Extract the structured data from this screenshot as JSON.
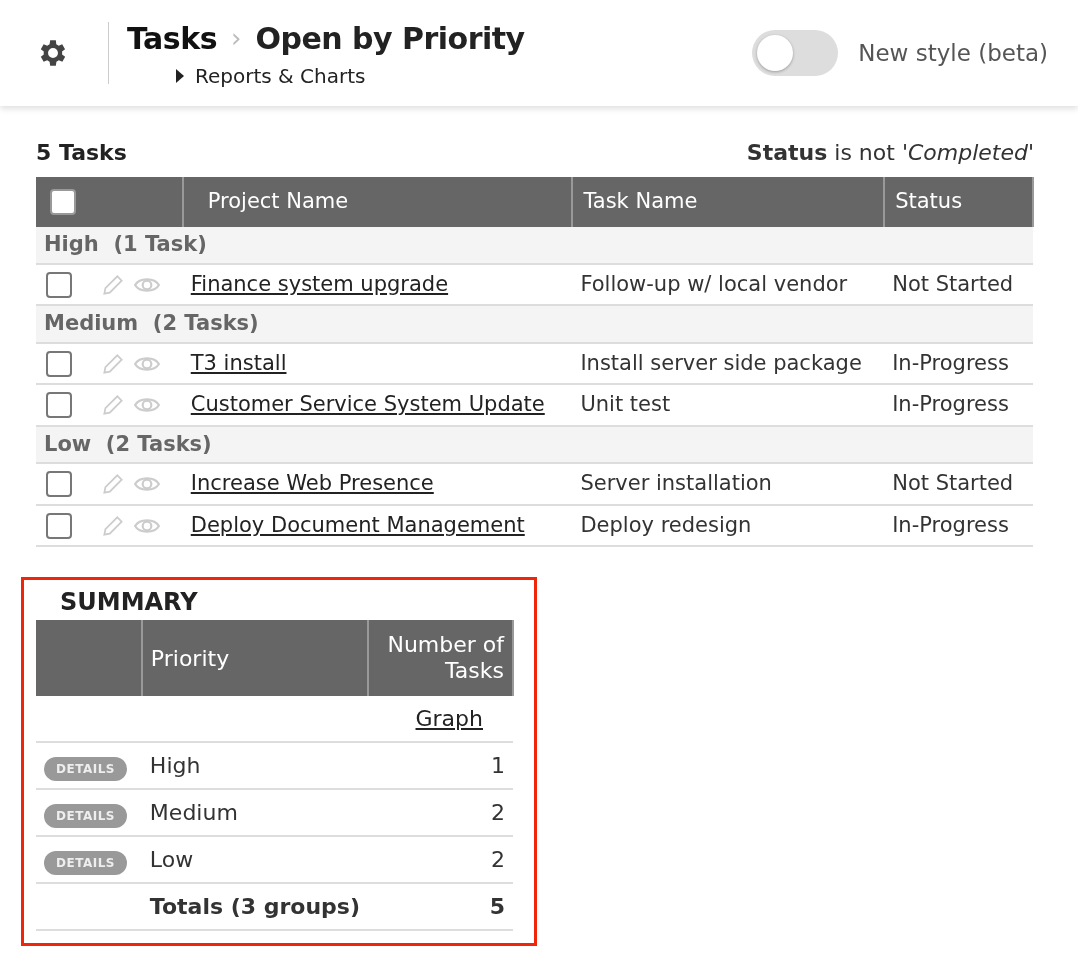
{
  "header": {
    "breadcrumb": "Tasks",
    "separator": "›",
    "title": "Open by Priority",
    "submenu": "Reports & Charts",
    "toggle": {
      "label": "New style (beta)",
      "on": false
    }
  },
  "list": {
    "count": "5 Tasks",
    "filter": "**Status** is not *'Completed'*",
    "select_all": {
      "checked": false
    },
    "columns": [
      "Project Name",
      "Task Name",
      "Status"
    ],
    "groups": [
      {
        "label": "High  (1 Task)",
        "rows": [
          {
            "project": "Finance system upgrade",
            "task": "Follow-up w/ local vendor",
            "status": "Not Started",
            "checked": false
          }
        ]
      },
      {
        "label": "Medium  (2 Tasks)",
        "rows": [
          {
            "project": "T3 install",
            "task": "Install server side package",
            "status": "In-Progress",
            "checked": false
          },
          {
            "project": "Customer Service System Update",
            "task": "Unit test",
            "status": "In-Progress",
            "checked": false
          }
        ]
      },
      {
        "label": "Low  (2 Tasks)",
        "rows": [
          {
            "project": "Increase Web Presence",
            "task": "Server installation",
            "status": "Not Started",
            "checked": false
          },
          {
            "project": "Deploy Document Management",
            "task": "Deploy redesign",
            "status": "In-Progress",
            "checked": false
          }
        ]
      }
    ]
  },
  "summary": {
    "title": "SUMMARY",
    "highlighted": true,
    "columns": [
      "Priority",
      "Number of Tasks"
    ],
    "graph_link": "Graph",
    "rows": [
      {
        "button": "DETAILS",
        "priority": "High",
        "count": "1"
      },
      {
        "button": "DETAILS",
        "priority": "Medium",
        "count": "2"
      },
      {
        "button": "DETAILS",
        "priority": "Low",
        "count": "2"
      }
    ],
    "totals": {
      "label": "Totals (3 groups)",
      "count": "5"
    }
  }
}
